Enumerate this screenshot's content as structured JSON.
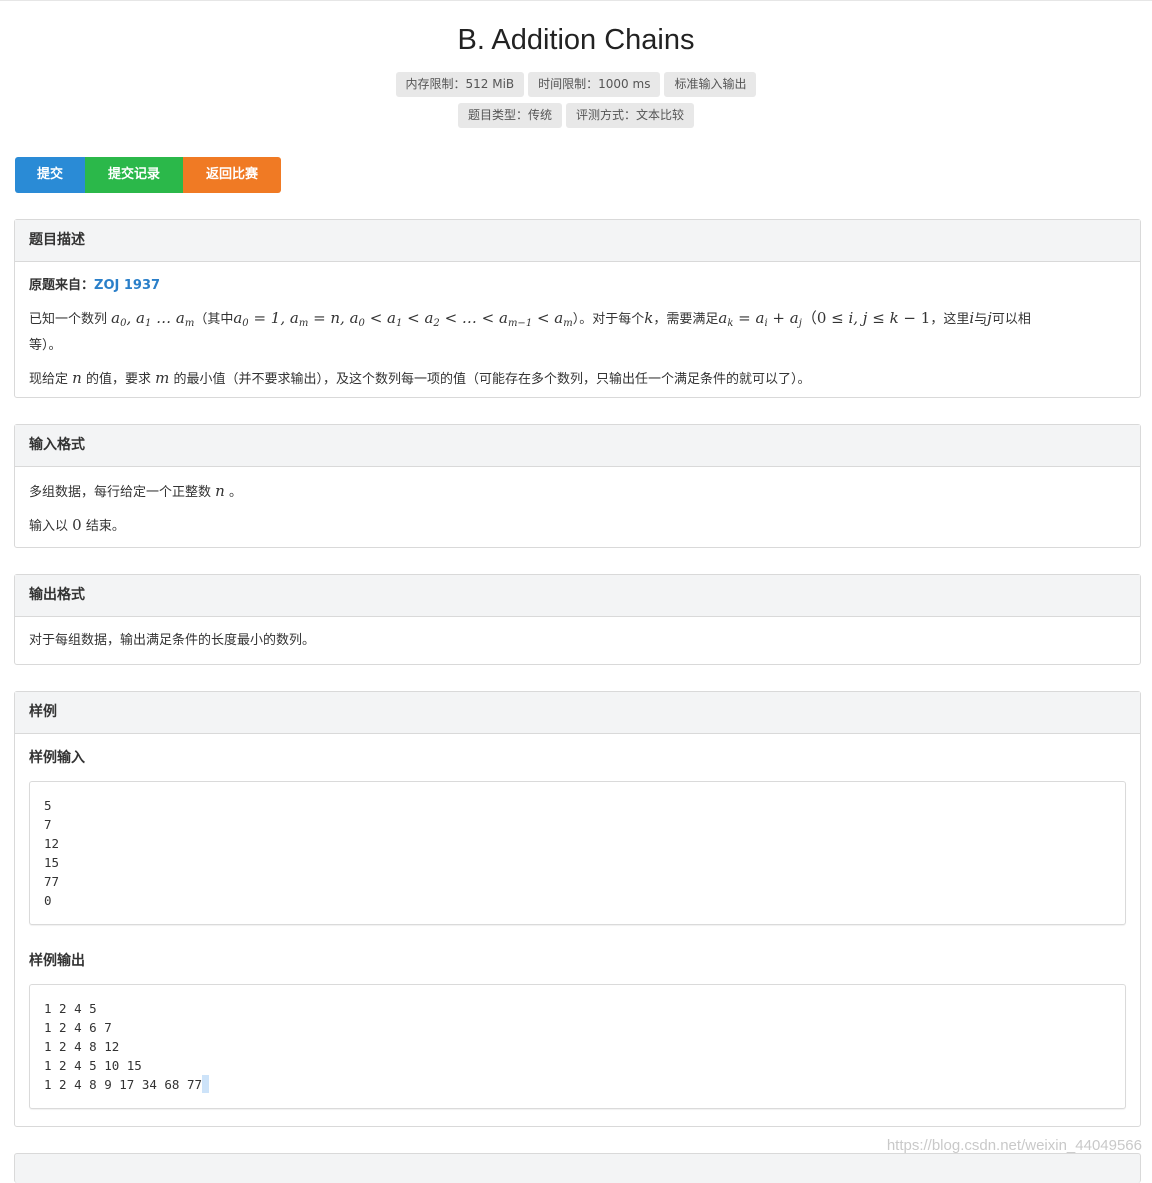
{
  "title": "B. Addition Chains",
  "tags_row1": [
    "内存限制：512 MiB",
    "时间限制：1000 ms",
    "标准输入输出"
  ],
  "tags_row2": [
    "题目类型：传统",
    "评测方式：文本比较"
  ],
  "buttons": {
    "submit": "提交",
    "records": "提交记录",
    "back": "返回比赛"
  },
  "colors": {
    "submit": "#2a8bd6",
    "records": "#2bb84a",
    "back": "#f07a24",
    "link": "#2a7fc9"
  },
  "description": {
    "heading": "题目描述",
    "source_label": "原题来自：",
    "source_link": "ZOJ 1937",
    "line1_a": "已知一个数列",
    "line1_b": "（其中",
    "line1_c": "）。对于每个",
    "line1_d": "，需要满足",
    "line1_e": "，这里",
    "line1_f": "与",
    "line1_g": "可以相",
    "line1_h": "等）。",
    "line2_a": "现给定",
    "line2_b": "的值，要求",
    "line2_c": "的最小值（并不要求输出），及这个数列每一项的值（可能存在多个数列，只输出任一个满足条件的就可以了）。"
  },
  "input_format": {
    "heading": "输入格式",
    "line1_a": "多组数据，每行给定一个正整数",
    "line1_b": "。",
    "line2_a": "输入以",
    "line2_b": "结束。"
  },
  "output_format": {
    "heading": "输出格式",
    "line1": "对于每组数据，输出满足条件的长度最小的数列。"
  },
  "samples": {
    "heading": "样例",
    "input_label": "样例输入",
    "input_lines": [
      "5",
      "7",
      "12",
      "15",
      "77",
      "0"
    ],
    "output_label": "样例输出",
    "output_lines": [
      "1 2 4 5",
      "1 2 4 6 7",
      "1 2 4 8 12",
      "1 2 4 5 10 15",
      "1 2 4 8 9 17 34 68 77"
    ]
  },
  "watermark": "https://blog.csdn.net/weixin_44049566"
}
